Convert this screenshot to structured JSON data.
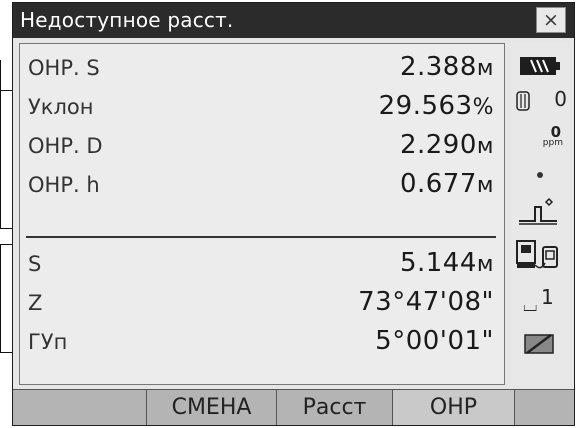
{
  "window": {
    "title": "Недоступное расст.",
    "close_symbol": "×"
  },
  "measurements_top": [
    {
      "label": "ОНР. S",
      "value": "2.388",
      "unit": "м"
    },
    {
      "label": "Уклон",
      "value": "29.563",
      "unit": "%"
    },
    {
      "label": "ОНР. D",
      "value": "2.290",
      "unit": "м"
    },
    {
      "label": "ОНР. h",
      "value": "0.677",
      "unit": "м"
    }
  ],
  "measurements_bottom": [
    {
      "label": "S",
      "value": "5.144",
      "unit": "м"
    },
    {
      "label": "Z",
      "value": "73°47'08\"",
      "unit": ""
    },
    {
      "label": "ГУп",
      "value": "5°00'01\"",
      "unit": ""
    }
  ],
  "status": {
    "prism_constant": "0",
    "ppm_value": "0",
    "ppm_label": "ppm",
    "face_number": "1",
    "icons": [
      "battery-icon",
      "prism-icon",
      "ppm-icon",
      "dot-icon",
      "target-icon",
      "device-icon",
      "face-icon",
      "edit-icon"
    ]
  },
  "softkeys": [
    {
      "label": ""
    },
    {
      "label": "СМЕНА"
    },
    {
      "label": "Расст"
    },
    {
      "label": "ОНР"
    },
    {
      "label": ""
    }
  ]
}
